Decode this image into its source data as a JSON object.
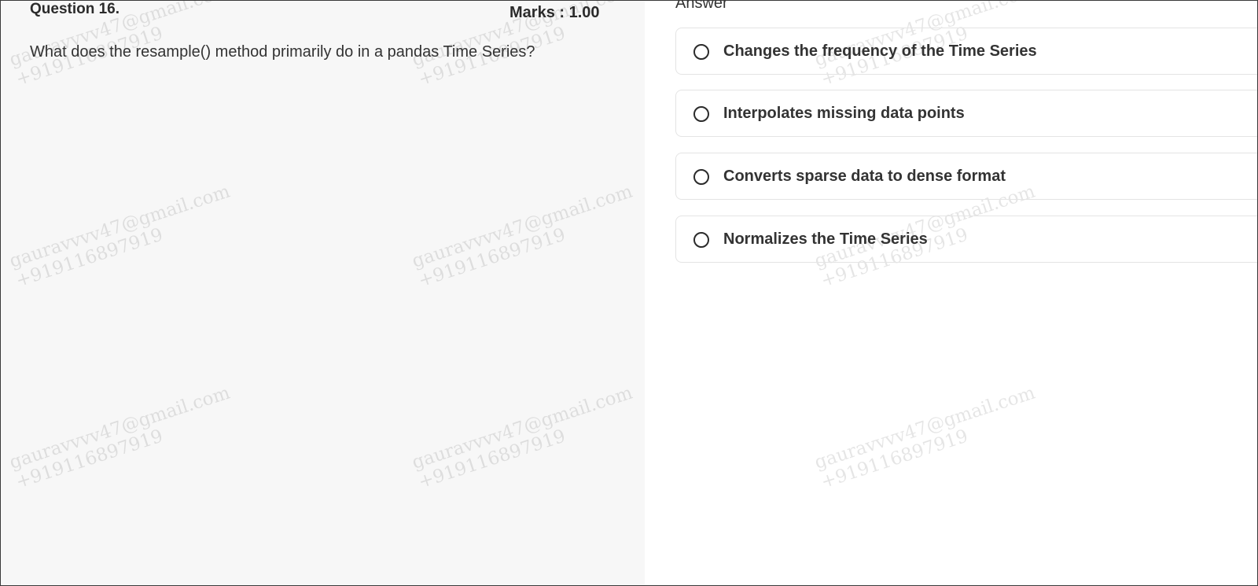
{
  "question": {
    "number_label": "Question 16.",
    "marks_label": "Marks : 1.00",
    "text": "What does the resample() method primarily do in a pandas Time Series?"
  },
  "answer": {
    "heading": "Answer",
    "options": [
      {
        "label": "Changes the frequency of the Time Series",
        "selected": false
      },
      {
        "label": "Interpolates missing data points",
        "selected": false
      },
      {
        "label": "Converts sparse data to dense format",
        "selected": false
      },
      {
        "label": "Normalizes the Time Series",
        "selected": false
      }
    ]
  },
  "watermark": {
    "email": "gauravvvv47@gmail.com",
    "phone": "+919116897919"
  }
}
